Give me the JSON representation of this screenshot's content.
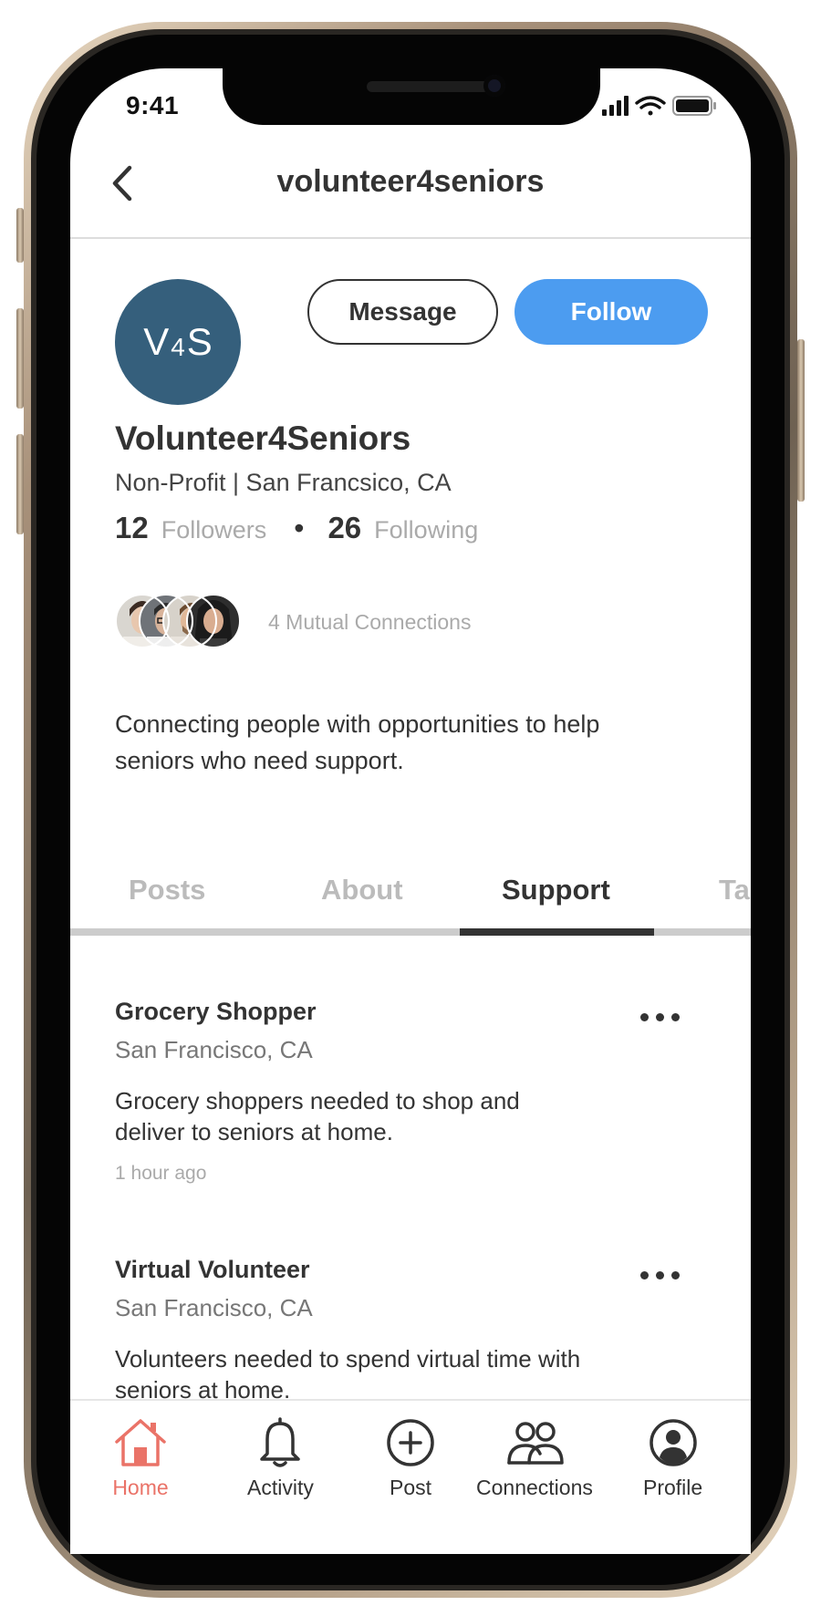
{
  "status_bar": {
    "time": "9:41"
  },
  "header": {
    "title": "volunteer4seniors"
  },
  "profile": {
    "avatar_text_left": "V",
    "avatar_text_mid": "4",
    "avatar_text_right": "S",
    "avatar_color": "#355f7c",
    "message_label": "Message",
    "follow_label": "Follow",
    "name": "Volunteer4Seniors",
    "subtitle": "Non-Profit | San Francsico, CA",
    "followers_count": "12",
    "followers_label": "Followers",
    "following_count": "26",
    "following_label": "Following",
    "mutual_label": "4 Mutual Connections",
    "bio": "Connecting people with opportunities to help seniors who need support."
  },
  "tabs": [
    {
      "label": "Posts"
    },
    {
      "label": "About"
    },
    {
      "label": "Support",
      "active": true
    },
    {
      "label": "Ta"
    }
  ],
  "posts": [
    {
      "title": "Grocery Shopper",
      "location": "San Francisco, CA",
      "description": "Grocery shoppers needed to shop and deliver to seniors at home.",
      "time": "1 hour ago"
    },
    {
      "title": "Virtual Volunteer",
      "location": "San Francisco, CA",
      "description": "Volunteers needed to spend virtual time with seniors at home."
    }
  ],
  "nav": [
    {
      "label": "Home",
      "icon": "home-icon",
      "active": true
    },
    {
      "label": "Activity",
      "icon": "bell-icon"
    },
    {
      "label": "Post",
      "icon": "plus-circle-icon"
    },
    {
      "label": "Connections",
      "icon": "people-icon"
    },
    {
      "label": "Profile",
      "icon": "user-circle-icon"
    }
  ],
  "colors": {
    "accent": "#4c9cf0",
    "active_nav": "#ea7368",
    "text": "#333333"
  }
}
